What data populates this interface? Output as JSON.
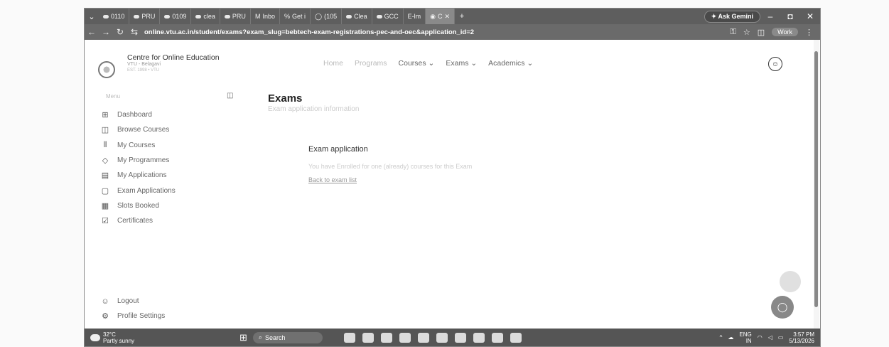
{
  "browser": {
    "tabs": [
      {
        "label": "0110"
      },
      {
        "label": "PRU"
      },
      {
        "label": "0109"
      },
      {
        "label": "clea"
      },
      {
        "label": "PRU"
      },
      {
        "label": "Inbo"
      },
      {
        "label": "Get i"
      },
      {
        "label": "(105"
      },
      {
        "label": "Clea"
      },
      {
        "label": "GCC"
      },
      {
        "label": "E-lm"
      },
      {
        "label": "C"
      }
    ],
    "new_tab": "+",
    "gemini_label": "✦ Ask Gemini",
    "url": "online.vtu.ac.in/student/exams?exam_slug=bebtech-exam-registrations-pec-and-oec&application_id=2",
    "profile_label": "Work"
  },
  "site": {
    "brand_name": "Centre for Online Education",
    "brand_sub": "VTU - Belagavi",
    "brand_sub2": "EST. 1998 • VTU",
    "nav": [
      {
        "label": "Home"
      },
      {
        "label": "Programs"
      },
      {
        "label": "Courses ⌄"
      },
      {
        "label": "Exams ⌄"
      },
      {
        "label": "Academics ⌄"
      }
    ]
  },
  "sidebar": {
    "menu_label": "Menu",
    "items": [
      {
        "label": "Dashboard",
        "icon": "grid-icon"
      },
      {
        "label": "Browse Courses",
        "icon": "book-icon"
      },
      {
        "label": "My Courses",
        "icon": "library-icon"
      },
      {
        "label": "My Programmes",
        "icon": "graduation-cap-icon"
      },
      {
        "label": "My Applications",
        "icon": "document-icon"
      },
      {
        "label": "Exam Applications",
        "icon": "clipboard-icon"
      },
      {
        "label": "Slots Booked",
        "icon": "calendar-icon"
      },
      {
        "label": "Certificates",
        "icon": "certificate-icon"
      }
    ],
    "bottom": [
      {
        "label": "Logout",
        "icon": "logout-icon"
      },
      {
        "label": "Profile Settings",
        "icon": "settings-icon"
      }
    ]
  },
  "main": {
    "title": "Exams",
    "subtitle": "Exam application information",
    "card_title": "Exam application",
    "card_message": "You have Enrolled for one (already) courses for this Exam",
    "back_link": "Back to exam list"
  },
  "taskbar": {
    "temperature": "32°C",
    "weather": "Partly sunny",
    "search_label": "Search",
    "lang": "ENG",
    "region": "IN",
    "time": "3:57 PM",
    "date": "5/13/2026"
  }
}
